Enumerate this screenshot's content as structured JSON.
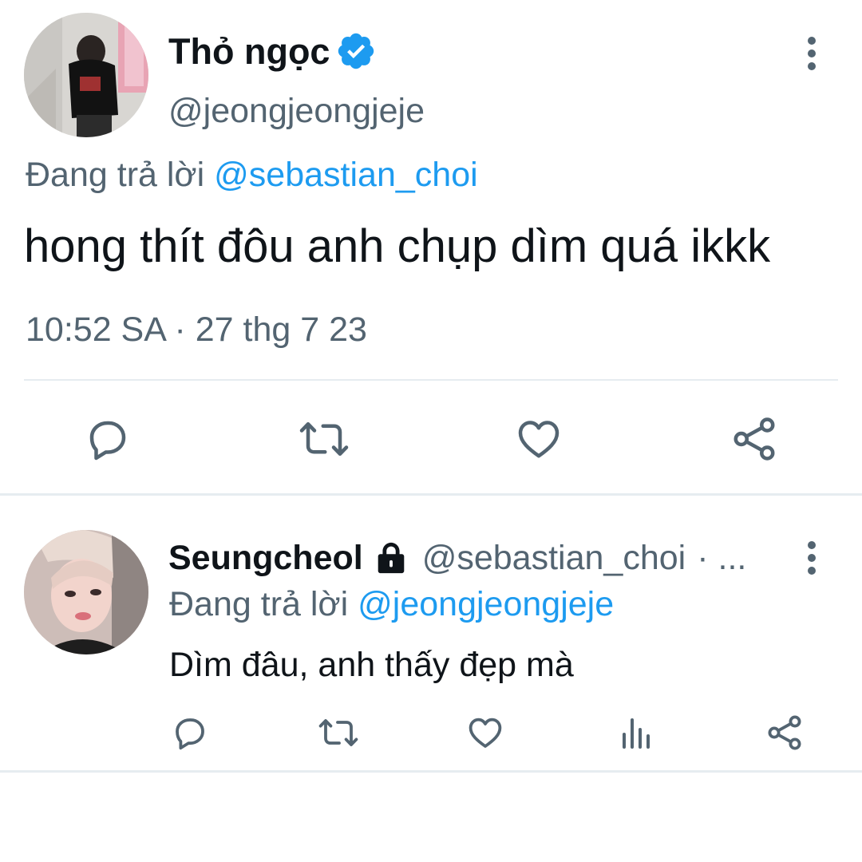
{
  "main_tweet": {
    "display_name": "Thỏ ngọc",
    "verified": true,
    "handle": "@jeongjeongjeje",
    "replying_prefix": "Đang trả lời",
    "replying_to": "@sebastian_choi",
    "text": "hong thít đôu anh chụp dìm quá ikkk",
    "timestamp": "10:52 SA · 27 thg 7 23",
    "actions": [
      "reply-icon",
      "retweet-icon",
      "like-icon",
      "share-icon"
    ]
  },
  "reply_tweet": {
    "display_name": "Seungcheol",
    "protected": true,
    "handle": "@sebastian_choi",
    "handle_suffix": "· ...",
    "replying_prefix": "Đang trả lời",
    "replying_to": "@jeongjeongjeje",
    "text": "Dìm đâu, anh thấy đẹp mà",
    "actions": [
      "reply-icon",
      "retweet-icon",
      "like-icon",
      "views-icon",
      "share-icon"
    ]
  },
  "colors": {
    "text_primary": "#0f1419",
    "text_secondary": "#536471",
    "accent": "#1d9bf0",
    "divider": "#e6ecf0"
  }
}
